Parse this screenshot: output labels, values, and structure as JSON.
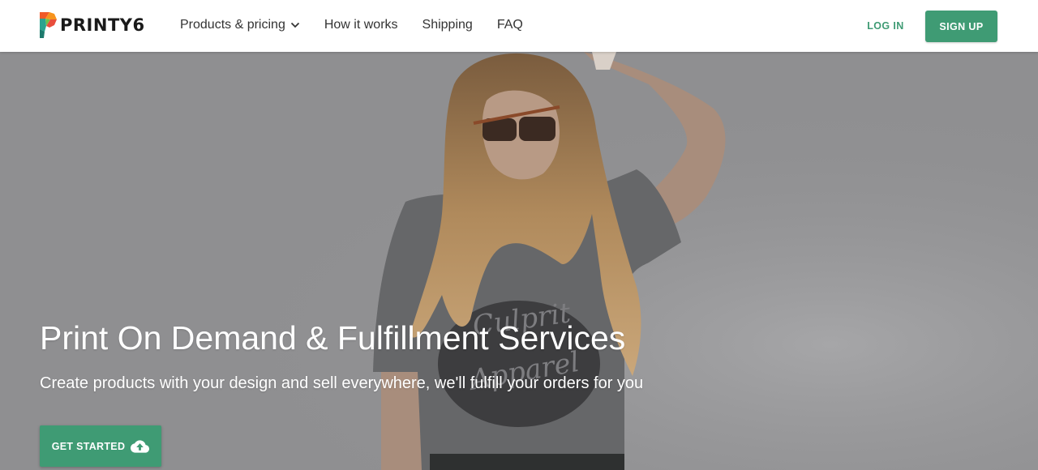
{
  "brand": {
    "name": "PRINTY6",
    "accent_color": "#3f9b74"
  },
  "nav": {
    "items": [
      {
        "label": "Products & pricing",
        "has_dropdown": true,
        "icon": "chevron-down-icon"
      },
      {
        "label": "How it works"
      },
      {
        "label": "Shipping"
      },
      {
        "label": "FAQ"
      }
    ],
    "login_label": "LOG IN",
    "signup_label": "SIGN UP"
  },
  "hero": {
    "title": "Print On Demand & Fulfillment Services",
    "subtitle": "Create products with your design and sell everywhere, we'll fulfill your orders for you",
    "cta_label": "GET STARTED",
    "cta_icon": "cloud-upload-icon",
    "shirt_print": "Culprit Apparel",
    "background_color": "#8f8f91"
  }
}
